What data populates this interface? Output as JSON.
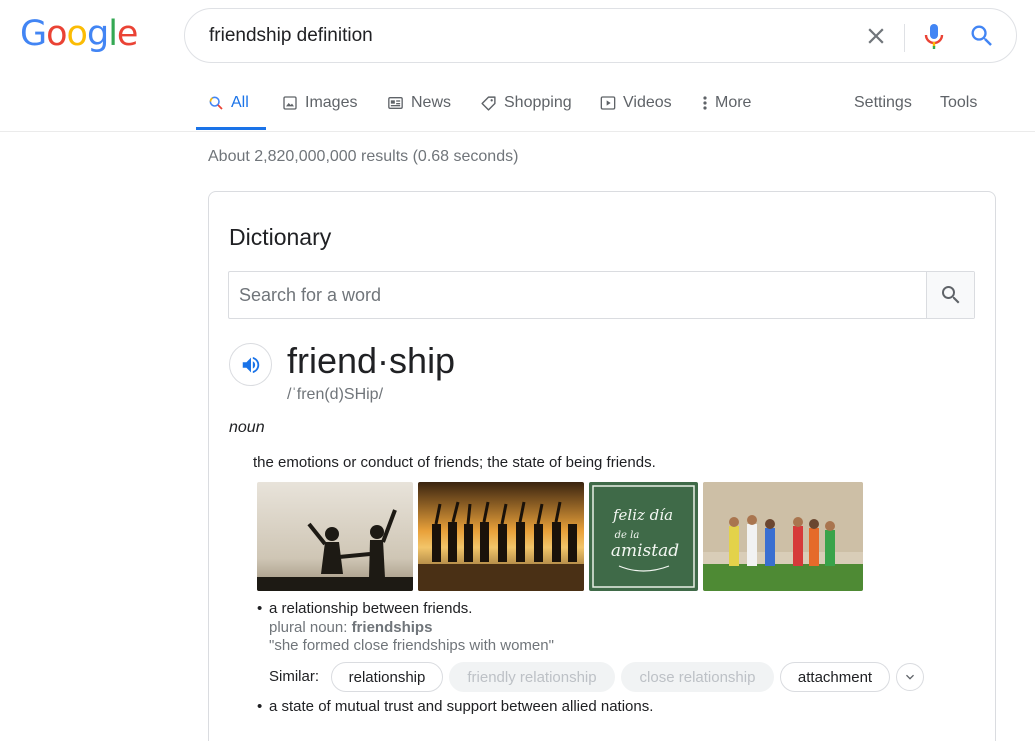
{
  "logo": {
    "letters": [
      "G",
      "o",
      "o",
      "g",
      "l",
      "e"
    ]
  },
  "search": {
    "query": "friendship definition"
  },
  "tabs": [
    {
      "label": "All",
      "icon": "search-icon"
    },
    {
      "label": "Images",
      "icon": "image-icon"
    },
    {
      "label": "News",
      "icon": "newspaper-icon"
    },
    {
      "label": "Shopping",
      "icon": "tag-icon"
    },
    {
      "label": "Videos",
      "icon": "play-icon"
    },
    {
      "label": "More",
      "icon": "more-vert-icon"
    }
  ],
  "tools": {
    "settings": "Settings",
    "tools": "Tools"
  },
  "results_count": "About 2,820,000,000 results (0.68 seconds)",
  "dictionary": {
    "title": "Dictionary",
    "search_placeholder": "Search for a word",
    "headword": "friend·ship",
    "phonetic": "/ˈfren(d)SHip/",
    "part_of_speech": "noun",
    "main_definition": "the emotions or conduct of friends; the state of being friends.",
    "image_overlay_text": [
      "feliz día",
      "de la",
      "amistad"
    ],
    "senses": [
      {
        "definition": "a relationship between friends.",
        "plural_label": "plural noun: ",
        "plural_value": "friendships",
        "example": "\"she formed close friendships with women\""
      },
      {
        "definition": "a state of mutual trust and support between allied nations."
      }
    ],
    "similar_label": "Similar:",
    "similar": [
      "relationship",
      "friendly relationship",
      "close relationship",
      "attachment"
    ]
  },
  "colors": {
    "accent": "#1a73e8",
    "text": "#202124",
    "muted": "#70757a",
    "border": "#dadce0"
  }
}
